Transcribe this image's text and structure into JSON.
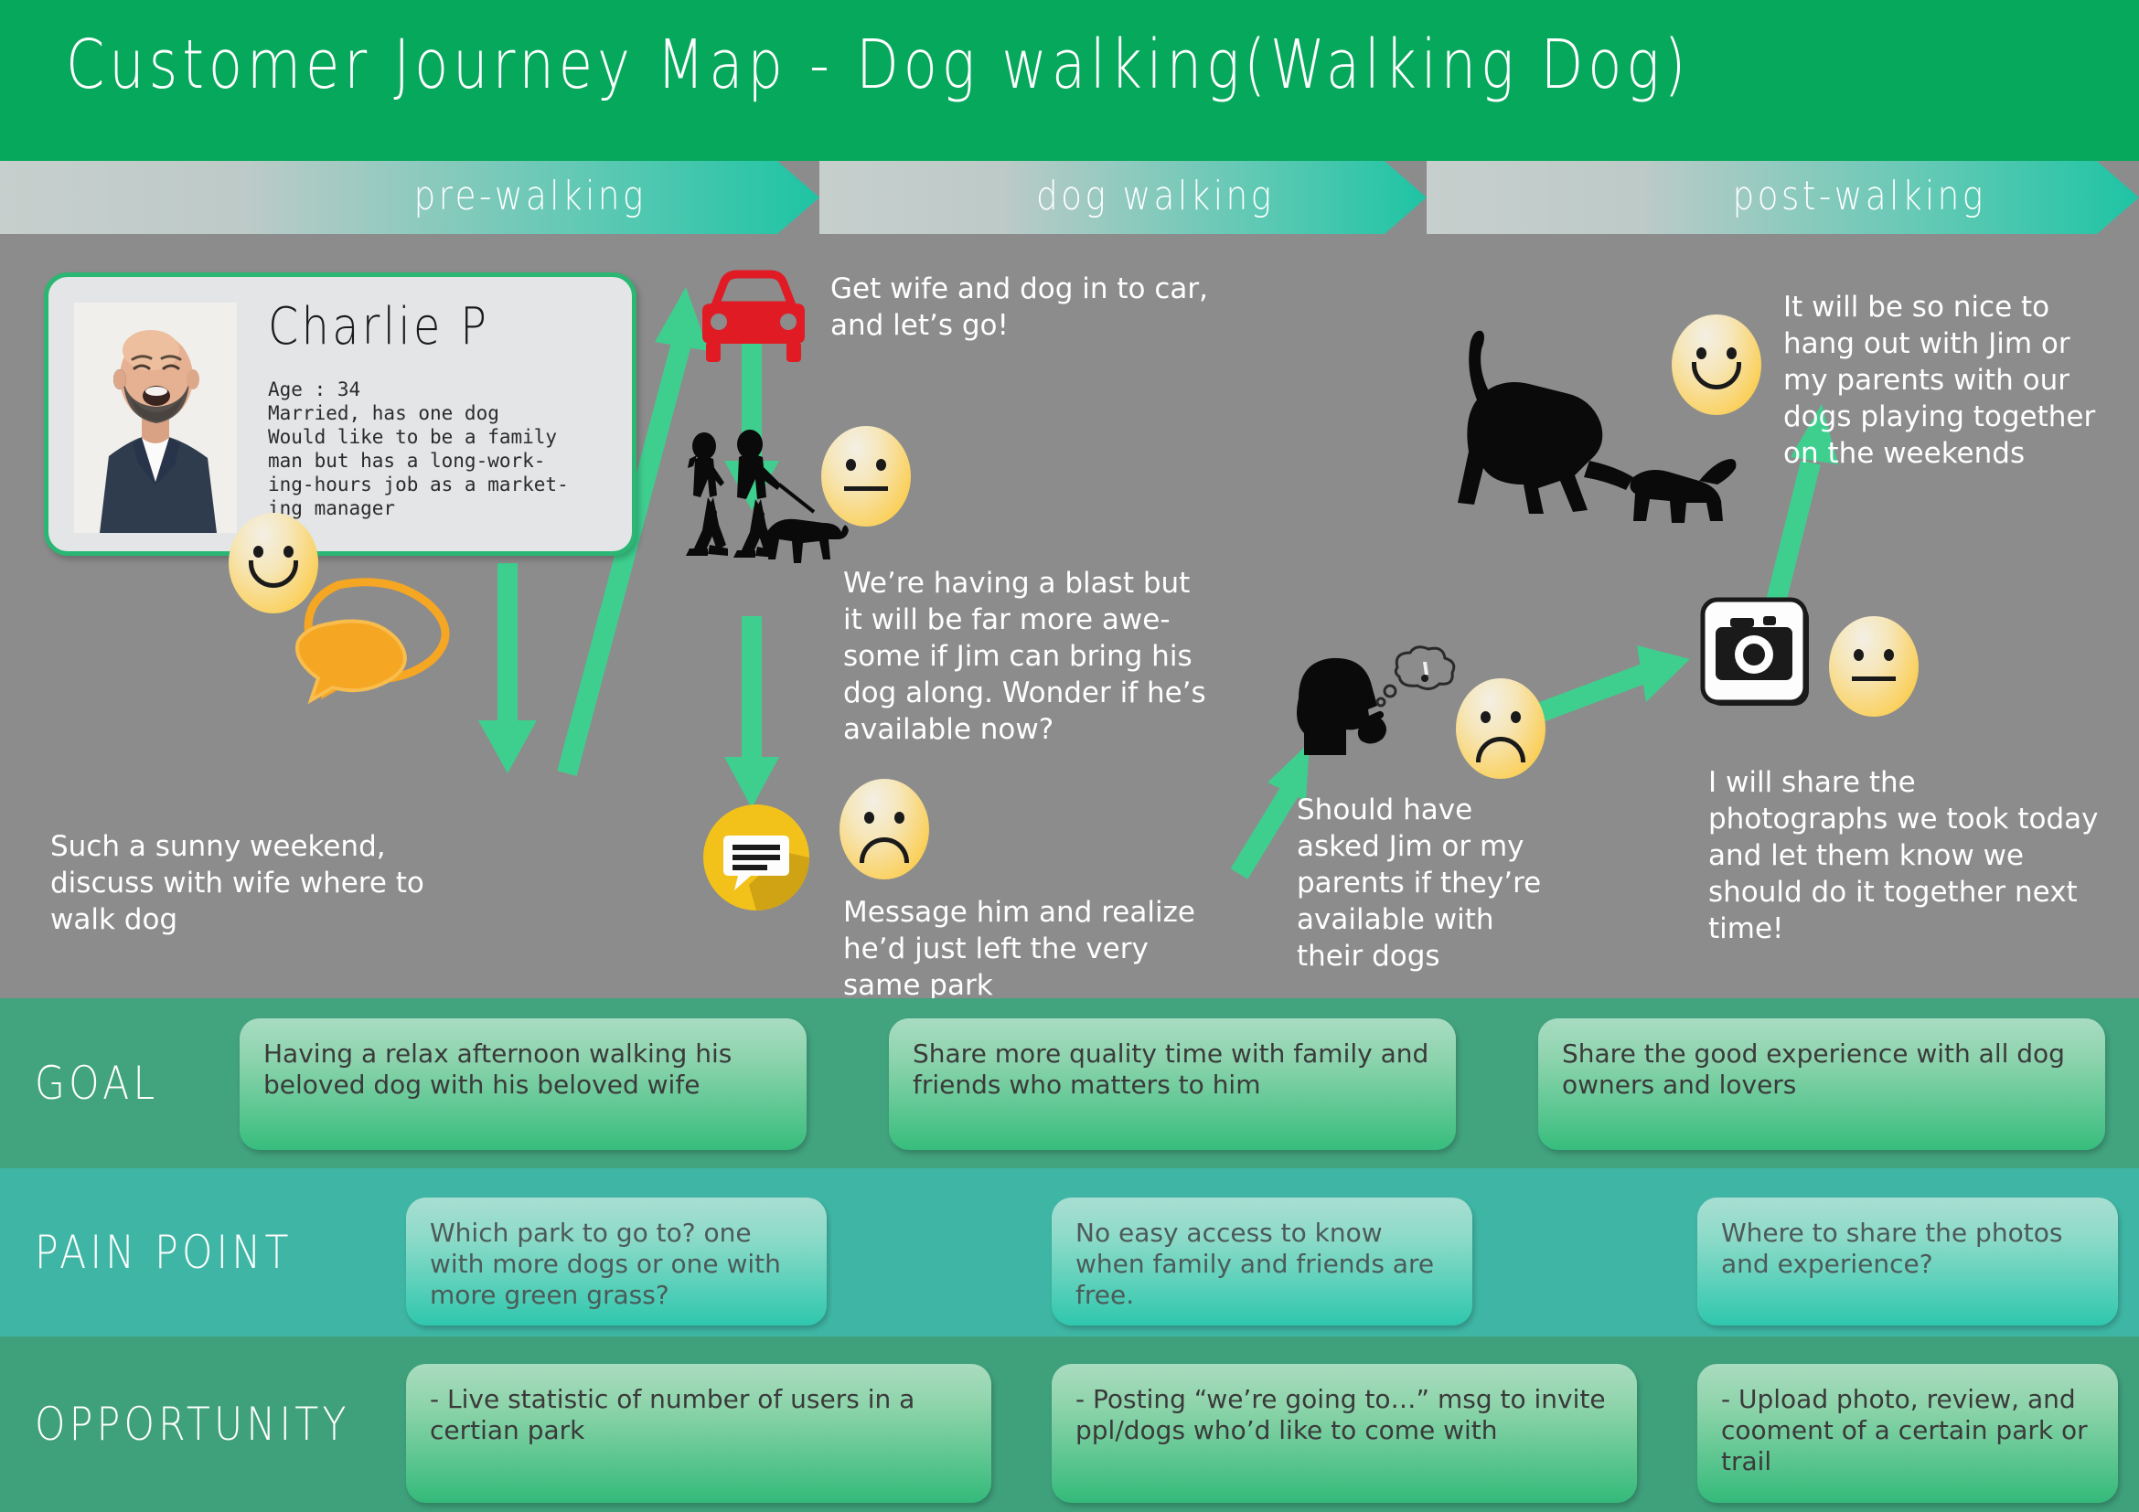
{
  "header": {
    "title": "Customer Journey Map - Dog walking(Walking Dog)"
  },
  "phases": [
    {
      "label": "pre-walking"
    },
    {
      "label": "dog walking"
    },
    {
      "label": "post-walking"
    }
  ],
  "persona": {
    "name": "Charlie P",
    "details": "Age : 34\nMarried, has one dog\nWould like to be a family\nman but has a long-work-\ning-hours job as a market-\ning manager",
    "photo_alt": "smiling bald bearded man in navy blazer"
  },
  "journey": {
    "step1": {
      "text": "Such a sunny weekend, discuss with wife where to walk dog",
      "emotion": "happy",
      "icon": "speech-bubbles-icon"
    },
    "step2": {
      "text": "Get wife and dog in to car, and let’s go!",
      "icon": "car-icon"
    },
    "step3": {
      "text": "We’re having a blast but it will be far more awe-some if Jim can bring his dog along. Wonder if he’s available now?",
      "emotion": "neutral",
      "icon": "people-walking-dog-icon"
    },
    "step4": {
      "text": "Message him and realize he’d just left the very same park",
      "emotion": "sad",
      "icon": "message-icon"
    },
    "step5": {
      "text": "Should have asked Jim or my parents if they’re available with their dogs",
      "emotion": "sad",
      "icon": "thinking-head-icon"
    },
    "step6": {
      "text": "It will be so nice to hang out with Jim or my parents with our dogs playing together on the weekends",
      "emotion": "happy",
      "icon": "dogs-playing-icon"
    },
    "step7": {
      "text": "I will share the photographs we took today and let them know we should do it together next time!",
      "emotion": "neutral",
      "icon": "camera-icon"
    }
  },
  "rows": {
    "goal": {
      "label": "GOAL",
      "cards": [
        "Having a relax afternoon walking his beloved dog with his beloved wife",
        "Share more quality time with family and friends who matters to him",
        "Share the good experience with all dog owners and lovers"
      ]
    },
    "pain": {
      "label": "PAIN POINT",
      "cards": [
        "Which park to go to?  one with more dogs or one with more green grass?",
        "No easy access to know when family and friends are free.",
        "Where to share the photos and experience?"
      ]
    },
    "opportunity": {
      "label": "OPPORTUNITY",
      "cards": [
        "- Live statistic of number of users in a certian park",
        "- Posting “we’re going to…” msg to invite ppl/dogs who’d like to come with",
        "- Upload photo, review, and cooment of a certain park or trail"
      ]
    }
  },
  "colors": {
    "header_green": "#06a85b",
    "stage_gray": "#8c8c8c",
    "arrow_green": "#3ecf8e",
    "car_red": "#e01b24",
    "bubble_orange": "#f5a623",
    "message_yellow": "#f2c21a",
    "goal_row": "#42a37f",
    "pain_row": "#3fb6a5",
    "opportunity_row": "#3fa07c"
  }
}
